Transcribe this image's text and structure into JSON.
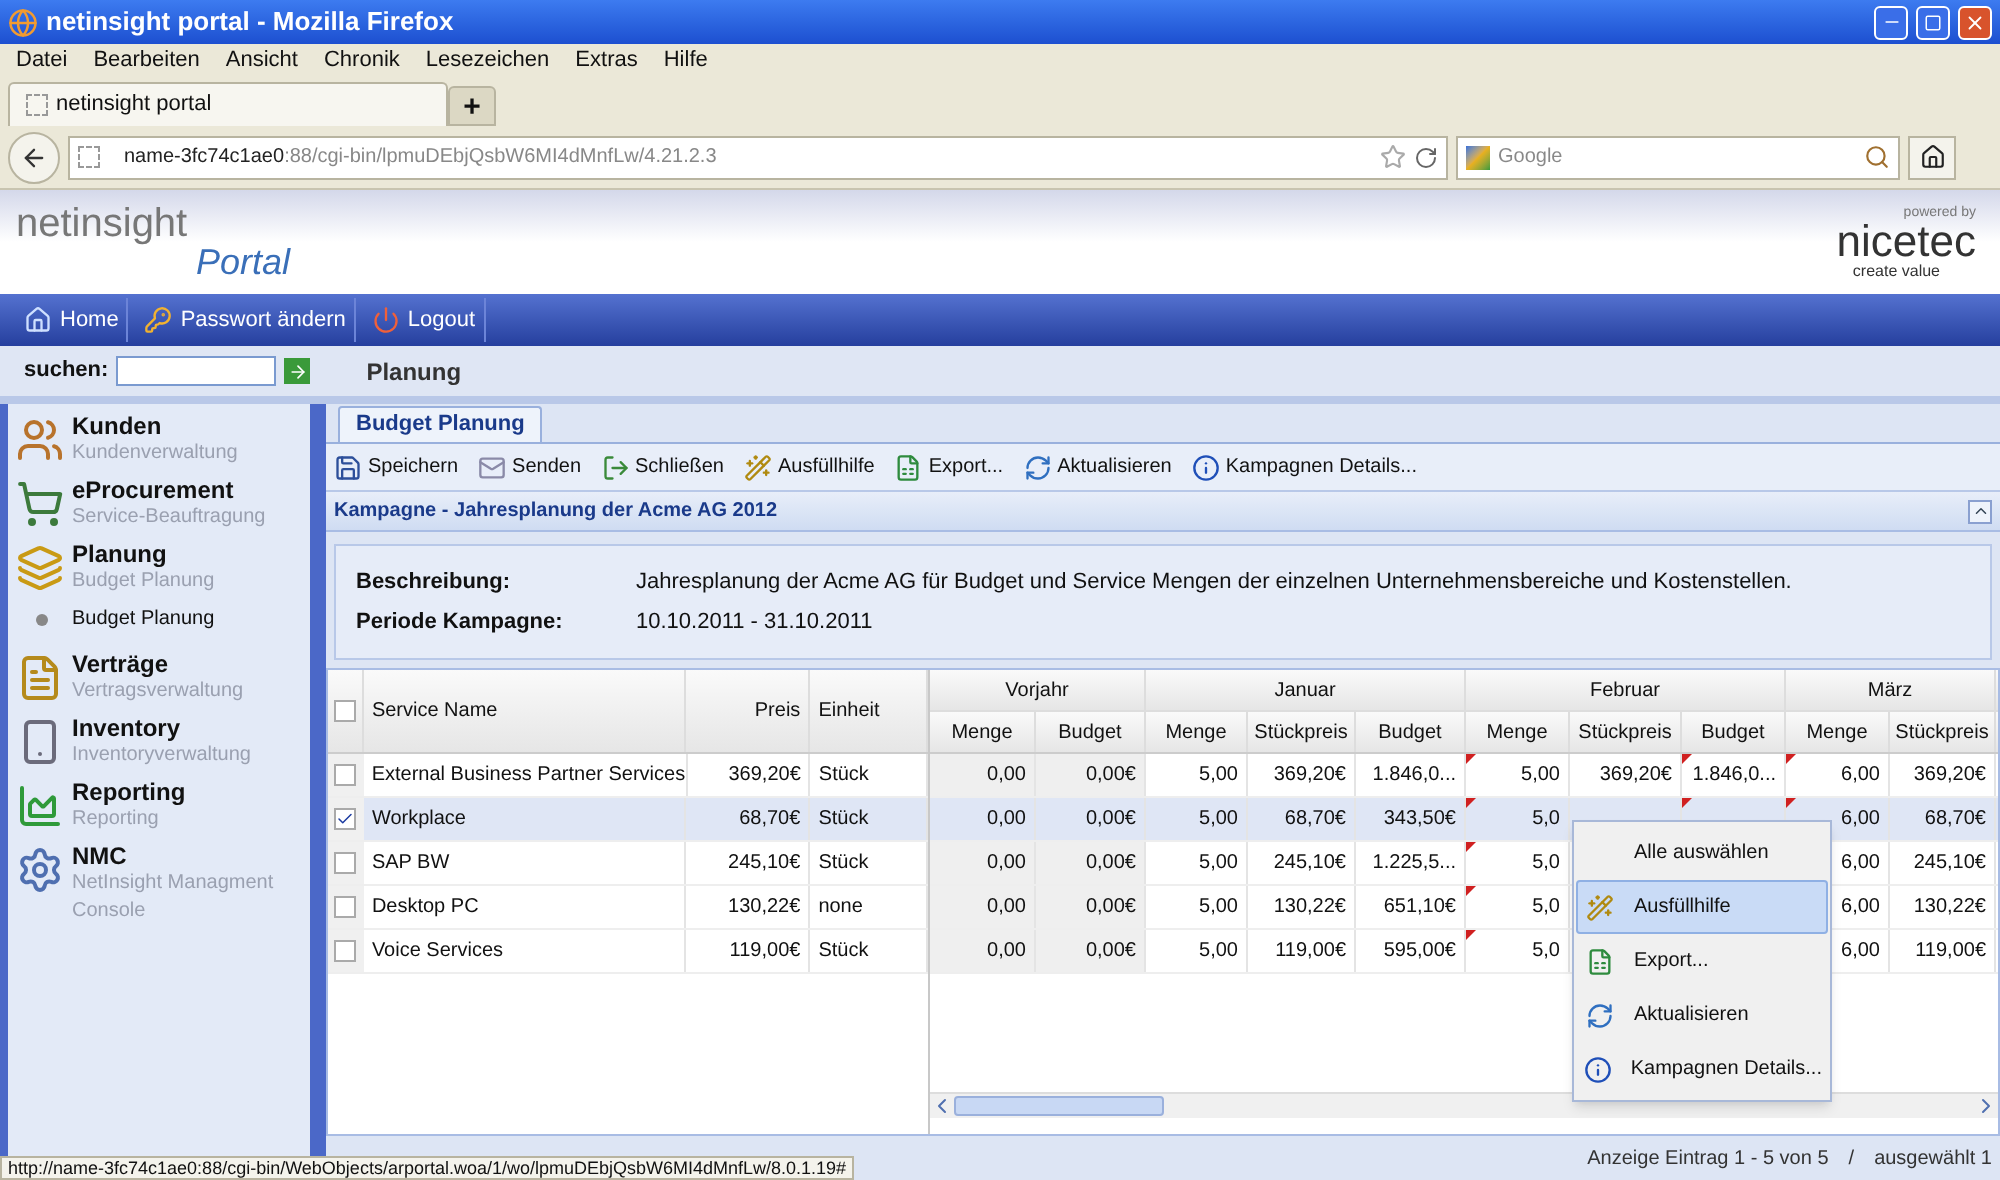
{
  "window": {
    "title": "netinsight portal - Mozilla Firefox"
  },
  "menu": [
    "Datei",
    "Bearbeiten",
    "Ansicht",
    "Chronik",
    "Lesezeichen",
    "Extras",
    "Hilfe"
  ],
  "browser_tab": {
    "label": "netinsight portal",
    "new_tab": "+"
  },
  "address": {
    "host": "name-3fc74c1ae0",
    "path": ":88/cgi-bin/lpmuDEbjQsbW6MI4dMnfLw/4.21.2.3"
  },
  "web_search": {
    "placeholder": "Google"
  },
  "logo": {
    "word": "netinsight",
    "sub": "Portal"
  },
  "vendor": {
    "powered": "powered by",
    "name": "nicetec",
    "slogan": "create value"
  },
  "nav": [
    {
      "label": "Home",
      "kind": "home"
    },
    {
      "label": "Passwort ändern",
      "kind": "key"
    },
    {
      "label": "Logout",
      "kind": "power"
    }
  ],
  "search": {
    "label": "suchen:"
  },
  "breadcrumb": "Planung",
  "sidebar": {
    "items": [
      {
        "title": "Kunden",
        "subtitle": "Kundenverwaltung",
        "kind": "users"
      },
      {
        "title": "eProcurement",
        "subtitle": "Service-Beauftragung",
        "kind": "cart"
      },
      {
        "title": "Planung",
        "subtitle": "Budget Planung",
        "kind": "books",
        "children": [
          {
            "label": "Budget Planung"
          }
        ]
      },
      {
        "title": "Verträge",
        "subtitle": "Vertragsverwaltung",
        "kind": "file"
      },
      {
        "title": "Inventory",
        "subtitle": "Inventoryverwaltung",
        "kind": "phone"
      },
      {
        "title": "Reporting",
        "subtitle": "Reporting",
        "kind": "chart"
      },
      {
        "title": "NMC",
        "subtitle": "NetInsight Managment Console",
        "kind": "gear"
      }
    ]
  },
  "tabs": [
    {
      "label": "Budget Planung",
      "selected": true
    }
  ],
  "toolbar": [
    {
      "label": "Speichern",
      "kind": "save"
    },
    {
      "label": "Senden",
      "kind": "mail"
    },
    {
      "label": "Schließen",
      "kind": "close"
    },
    {
      "label": "Ausfüllhilfe",
      "kind": "wand"
    },
    {
      "label": "Export...",
      "kind": "excel"
    },
    {
      "label": "Aktualisieren",
      "kind": "refresh"
    },
    {
      "label": "Kampagnen Details...",
      "kind": "info"
    }
  ],
  "panel": {
    "title": "Kampagne - Jahresplanung der Acme AG 2012",
    "fields": [
      {
        "label": "Beschreibung:",
        "value": "Jahresplanung der Acme AG für Budget und Service Mengen der einzelnen Unternehmensbereiche und Kostenstellen."
      },
      {
        "label": "Periode Kampagne:",
        "value": "10.10.2011 - 31.10.2011"
      }
    ]
  },
  "table": {
    "all_checked": false,
    "columns": [
      "Service Name",
      "Preis",
      "Einheit"
    ],
    "groups": [
      {
        "label": "Vorjahr",
        "columns": [
          {
            "label": "Menge",
            "modified": false
          },
          {
            "label": "Budget",
            "modified": false
          }
        ]
      },
      {
        "label": "Januar",
        "columns": [
          {
            "label": "Menge",
            "modified": false
          },
          {
            "label": "Stückpreis",
            "modified": false
          },
          {
            "label": "Budget",
            "modified": false
          }
        ]
      },
      {
        "label": "Februar",
        "columns": [
          {
            "label": "Menge",
            "modified": true
          },
          {
            "label": "Stückpreis",
            "modified": false
          },
          {
            "label": "Budget",
            "modified": true
          }
        ]
      },
      {
        "label": "März",
        "columns": [
          {
            "label": "Menge",
            "modified": true
          },
          {
            "label": "Stückpreis",
            "modified": false
          }
        ]
      }
    ],
    "rows": [
      {
        "checked": false,
        "selected": false,
        "cells": [
          "External Business Partner Services",
          "369,20€",
          "Stück"
        ],
        "months": [
          [
            "0,00",
            "0,00€"
          ],
          [
            "5,00",
            "369,20€",
            "1.846,0..."
          ],
          [
            "5,00",
            "369,20€",
            "1.846,0..."
          ],
          [
            "6,00",
            "369,20€"
          ]
        ]
      },
      {
        "checked": true,
        "selected": true,
        "cells": [
          "Workplace",
          "68,70€",
          "Stück"
        ],
        "months": [
          [
            "0,00",
            "0,00€"
          ],
          [
            "5,00",
            "68,70€",
            "343,50€"
          ],
          [
            "5,0"
          ],
          [
            "6,00",
            "68,70€"
          ]
        ]
      },
      {
        "checked": false,
        "selected": false,
        "cells": [
          "SAP BW",
          "245,10€",
          "Stück"
        ],
        "months": [
          [
            "0,00",
            "0,00€"
          ],
          [
            "5,00",
            "245,10€",
            "1.225,5..."
          ],
          [
            "5,0"
          ],
          [
            "6,00",
            "245,10€"
          ]
        ]
      },
      {
        "checked": false,
        "selected": false,
        "cells": [
          "Desktop PC",
          "130,22€",
          "none"
        ],
        "months": [
          [
            "0,00",
            "0,00€"
          ],
          [
            "5,00",
            "130,22€",
            "651,10€"
          ],
          [
            "5,0"
          ],
          [
            "6,00",
            "130,22€"
          ]
        ]
      },
      {
        "checked": false,
        "selected": false,
        "cells": [
          "Voice Services",
          "119,00€",
          "Stück"
        ],
        "months": [
          [
            "0,00",
            "0,00€"
          ],
          [
            "5,00",
            "119,00€",
            "595,00€"
          ],
          [
            "5,0"
          ],
          [
            "6,00",
            "119,00€"
          ]
        ]
      }
    ]
  },
  "context_menu": [
    {
      "label": "Alle auswählen",
      "kind": "none",
      "selected": false
    },
    {
      "label": "Ausfüllhilfe",
      "kind": "wand",
      "selected": true
    },
    {
      "label": "Export...",
      "kind": "excel",
      "selected": false
    },
    {
      "label": "Aktualisieren",
      "kind": "refresh",
      "selected": false
    },
    {
      "label": "Kampagnen Details...",
      "kind": "info",
      "selected": false
    }
  ],
  "footer": {
    "paging": "Anzeige Eintrag 1 - 5 von 5",
    "separator": "/",
    "selection": "ausgewählt 1"
  },
  "status_url": "http://name-3fc74c1ae0:88/cgi-bin/WebObjects/arportal.woa/1/wo/lpmuDEbjQsbW6MI4dMnfLw/8.0.1.19#"
}
